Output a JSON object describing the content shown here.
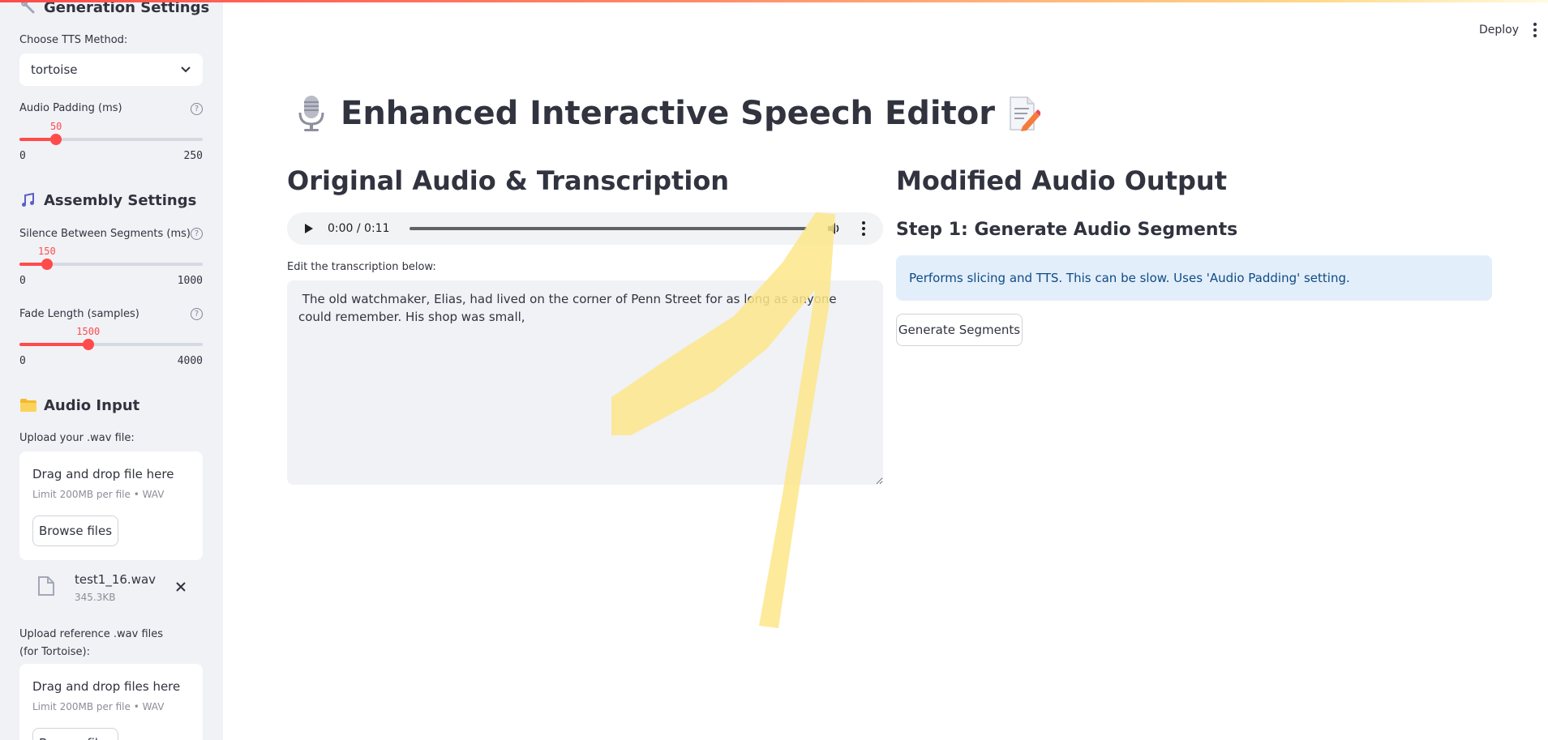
{
  "sidebar": {
    "generation_heading": "Generation Settings",
    "tts_method_label": "Choose TTS Method:",
    "tts_method_value": "tortoise",
    "audio_padding": {
      "label": "Audio Padding (ms)",
      "value": "50",
      "min": "0",
      "max": "250",
      "value_fraction": 0.2
    },
    "assembly_heading": "Assembly Settings",
    "silence": {
      "label": "Silence Between Segments (ms)",
      "value": "150",
      "min": "0",
      "max": "1000",
      "value_fraction": 0.15
    },
    "fade": {
      "label": "Fade Length (samples)",
      "value": "1500",
      "min": "0",
      "max": "4000",
      "value_fraction": 0.375
    },
    "audio_input_heading": "Audio Input",
    "upload_label": "Upload your .wav file:",
    "dropzone1": {
      "title": "Drag and drop file here",
      "limit": "Limit 200MB per file • WAV",
      "button": "Browse files"
    },
    "uploaded_file": {
      "name": "test1_16.wav",
      "size": "345.3KB"
    },
    "ref_label": "Upload reference .wav files (for Tortoise):",
    "dropzone2": {
      "title": "Drag and drop files here",
      "limit": "Limit 200MB per file • WAV",
      "button": "Browse files"
    }
  },
  "header": {
    "deploy": "Deploy"
  },
  "main": {
    "title": "Enhanced Interactive Speech Editor",
    "left": {
      "heading": "Original Audio & Transcription",
      "audio_time": "0:00 / 0:11",
      "textarea_label": "Edit the transcription below:",
      "transcription": " The old watchmaker, Elias, had lived on the corner of Penn Street for as long as anyone could remember. His shop was small,"
    },
    "right": {
      "heading": "Modified Audio Output",
      "step1": "Step 1: Generate Audio Segments",
      "info": "Performs slicing and TTS. This can be slow. Uses 'Audio Padding' setting.",
      "generate_button": "Generate Segments"
    }
  },
  "colors": {
    "accent": "#ff4b4b",
    "info_bg": "#e3eefb",
    "info_text": "#0f4b84",
    "highlighter": "#fde68a"
  }
}
